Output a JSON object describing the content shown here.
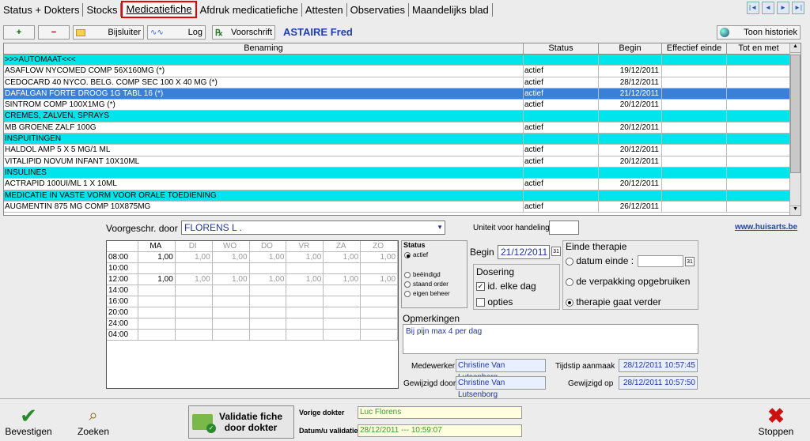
{
  "tabs": [
    "Status + Dokters",
    "Stocks",
    "Medicatiefiche",
    "Afdruk medicatiefiche",
    "Attesten",
    "Observaties",
    "Maandelijks blad"
  ],
  "nav": [
    "|◄",
    "◄",
    "►",
    "►|"
  ],
  "toolbar": {
    "add": "+",
    "remove": "−",
    "bijsluiter": "Bijsluiter",
    "log": "Log",
    "voorschrift": "Voorschrift",
    "patient": "ASTAIRE Fred",
    "historiek": "Toon historiek"
  },
  "columns": [
    "Benaming",
    "Status",
    "Begin",
    "Effectief einde",
    "Tot en met"
  ],
  "rows": [
    {
      "type": "cat",
      "name": ">>>AUTOMAAT<<<",
      "status": "",
      "begin": ""
    },
    {
      "type": "med",
      "name": "ASAFLOW NYCOMED COMP  56X160MG (*)",
      "status": "actief",
      "begin": "19/12/2011"
    },
    {
      "type": "med",
      "name": "CEDOCARD 40 NYCO. BELG. COMP SEC 100 X 40 MG (*)",
      "status": "actief",
      "begin": "28/12/2011"
    },
    {
      "type": "sel",
      "name": "DAFALGAN FORTE DROOG 1G TABL 16 (*)",
      "status": "actief",
      "begin": "21/12/2011"
    },
    {
      "type": "med",
      "name": "SINTROM COMP 100X1MG (*)",
      "status": "actief",
      "begin": "20/12/2011"
    },
    {
      "type": "cat",
      "name": " CREMES, ZALVEN, SPRAYS",
      "status": "",
      "begin": ""
    },
    {
      "type": "med",
      "name": "MB GROENE ZALF 100G",
      "status": "actief",
      "begin": "20/12/2011"
    },
    {
      "type": "cat",
      "name": " INSPUITINGEN",
      "status": "",
      "begin": ""
    },
    {
      "type": "med",
      "name": "HALDOL AMP 5 X 5 MG/1 ML",
      "status": "actief",
      "begin": "20/12/2011"
    },
    {
      "type": "med",
      "name": "VITALIPID NOVUM INFANT 10X10ML",
      "status": "actief",
      "begin": "20/12/2011"
    },
    {
      "type": "cat",
      "name": " INSULINES",
      "status": "",
      "begin": ""
    },
    {
      "type": "med",
      "name": "ACTRAPID 100UI/ML 1 X 10ML",
      "status": "actief",
      "begin": "20/12/2011"
    },
    {
      "type": "cat",
      "name": " MEDICATIE IN VASTE VORM VOOR ORALE TOEDIENING",
      "status": "",
      "begin": ""
    },
    {
      "type": "med",
      "name": "AUGMENTIN 875 MG COMP 10X875MG",
      "status": "actief",
      "begin": "26/12/2011"
    }
  ],
  "prescriber": {
    "label": "Voorgeschr. door",
    "value": "FLORENS L .",
    "unit_label": "Uniteit voor handeling",
    "unit_value": ""
  },
  "link": "www.huisarts.be",
  "schedule": {
    "days": [
      "MA",
      "DI",
      "WO",
      "DO",
      "VR",
      "ZA",
      "ZO"
    ],
    "times": [
      "08:00",
      "10:00",
      "12:00",
      "14:00",
      "16:00",
      "20:00",
      "24:00",
      "04:00"
    ],
    "values": [
      [
        "1,00",
        "1,00",
        "1,00",
        "1,00",
        "1,00",
        "1,00",
        "1,00"
      ],
      [
        "",
        "",
        "",
        "",
        "",
        "",
        ""
      ],
      [
        "1,00",
        "1,00",
        "1,00",
        "1,00",
        "1,00",
        "1,00",
        "1,00"
      ],
      [
        "",
        "",
        "",
        "",
        "",
        "",
        ""
      ],
      [
        "",
        "",
        "",
        "",
        "",
        "",
        ""
      ],
      [
        "",
        "",
        "",
        "",
        "",
        "",
        ""
      ],
      [
        "",
        "",
        "",
        "",
        "",
        "",
        ""
      ],
      [
        "",
        "",
        "",
        "",
        "",
        "",
        ""
      ]
    ]
  },
  "status": {
    "title": "Status",
    "options": [
      "actief",
      "beëindigd",
      "staand order",
      "eigen beheer"
    ],
    "selected": 0
  },
  "begin": {
    "label": "Begin",
    "value": "21/12/2011"
  },
  "dosering": {
    "title": "Dosering",
    "daily": "id. elke dag",
    "opties": "opties"
  },
  "einde": {
    "title": "Einde therapie",
    "datum": "datum einde :",
    "verpakking": "de verpakking opgebruiken",
    "verder": "therapie gaat verder"
  },
  "opmerkingen": {
    "label": "Opmerkingen",
    "value": "Bij pijn max 4 per dag"
  },
  "meta": {
    "medewerker_label": "Medewerker",
    "medewerker": "Christine Van Lutsenborg",
    "aanmaak_label": "Tijdstip aanmaak",
    "aanmaak": "28/12/2011 10:57:45",
    "gewijzigd_label": "Gewijzigd door",
    "gewijzigd": "Christine Van Lutsenborg",
    "gewijzigd_op_label": "Gewijzigd op",
    "gewijzigd_op": "28/12/2011 10:57:50"
  },
  "bottom": {
    "bevestigen": "Bevestigen",
    "zoeken": "Zoeken",
    "validatie1": "Validatie fiche",
    "validatie2": "door dokter",
    "vorige_label": "Vorige dokter",
    "vorige": "Luc Florens",
    "datum_label": "Datum/u validatie",
    "datum": "28/12/2011 --- 10:59:07",
    "stoppen": "Stoppen"
  }
}
